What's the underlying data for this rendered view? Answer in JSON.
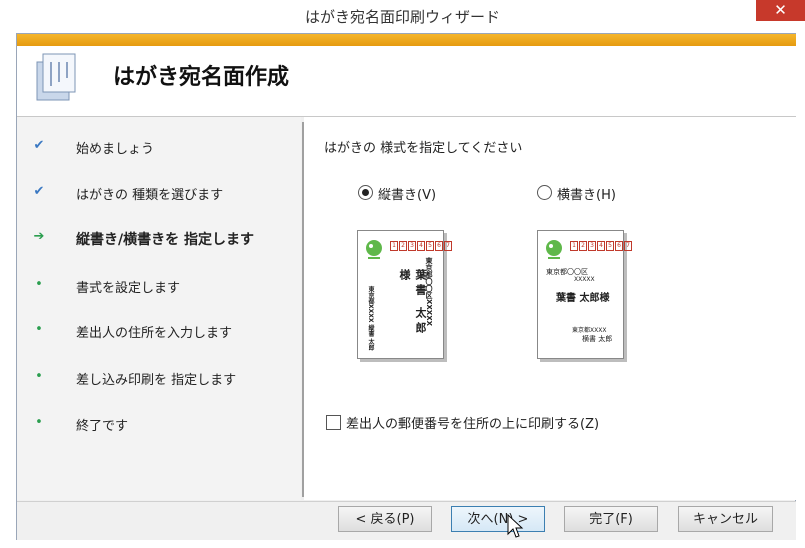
{
  "window": {
    "title": "はがき宛名面印刷ウィザード",
    "close_symbol": "✕"
  },
  "header": {
    "title": "はがき宛名面作成"
  },
  "steps": [
    {
      "label": "始めましょう",
      "state": "done"
    },
    {
      "label": "はがきの 種類を選びます",
      "state": "done"
    },
    {
      "label": "縦書き/横書きを 指定します",
      "state": "current"
    },
    {
      "label": "書式を設定します",
      "state": "pending"
    },
    {
      "label": "差出人の住所を入力します",
      "state": "pending"
    },
    {
      "label": "差し込み印刷を 指定します",
      "state": "pending"
    },
    {
      "label": "終了です",
      "state": "pending"
    }
  ],
  "marks": {
    "done": "✔",
    "current": "➔",
    "pending": "•"
  },
  "main": {
    "prompt": "はがきの 様式を指定してください",
    "vertical": {
      "label": "縦書き(V)",
      "selected": true
    },
    "horizontal": {
      "label": "横書き(H)",
      "selected": false
    },
    "preview": {
      "zip": [
        "1",
        "2",
        "3",
        "4",
        "5",
        "6",
        "7"
      ],
      "v_address": "東京都〇〇区XXXXX",
      "v_name": "葉書 太郎 様",
      "v_sender": "東京都XXXX 縦書 太郎",
      "h_address": "東京都〇〇区",
      "h_address2": "XXXXX",
      "h_name": "葉書 太郎様",
      "h_sender": "東京都XXXX",
      "h_sender_name": "横書 太郎"
    },
    "checkbox": {
      "label": "差出人の郵便番号を住所の上に印刷する(Z)",
      "checked": false
    }
  },
  "buttons": {
    "back": "< 戻る(P)",
    "next": "次へ(N) >",
    "finish": "完了(F)",
    "cancel": "キャンセル"
  },
  "colors": {
    "accent_bar": "#f5b52c",
    "close": "#c7392b",
    "check": "#3a78c2",
    "bullet": "#2b9e4f"
  }
}
